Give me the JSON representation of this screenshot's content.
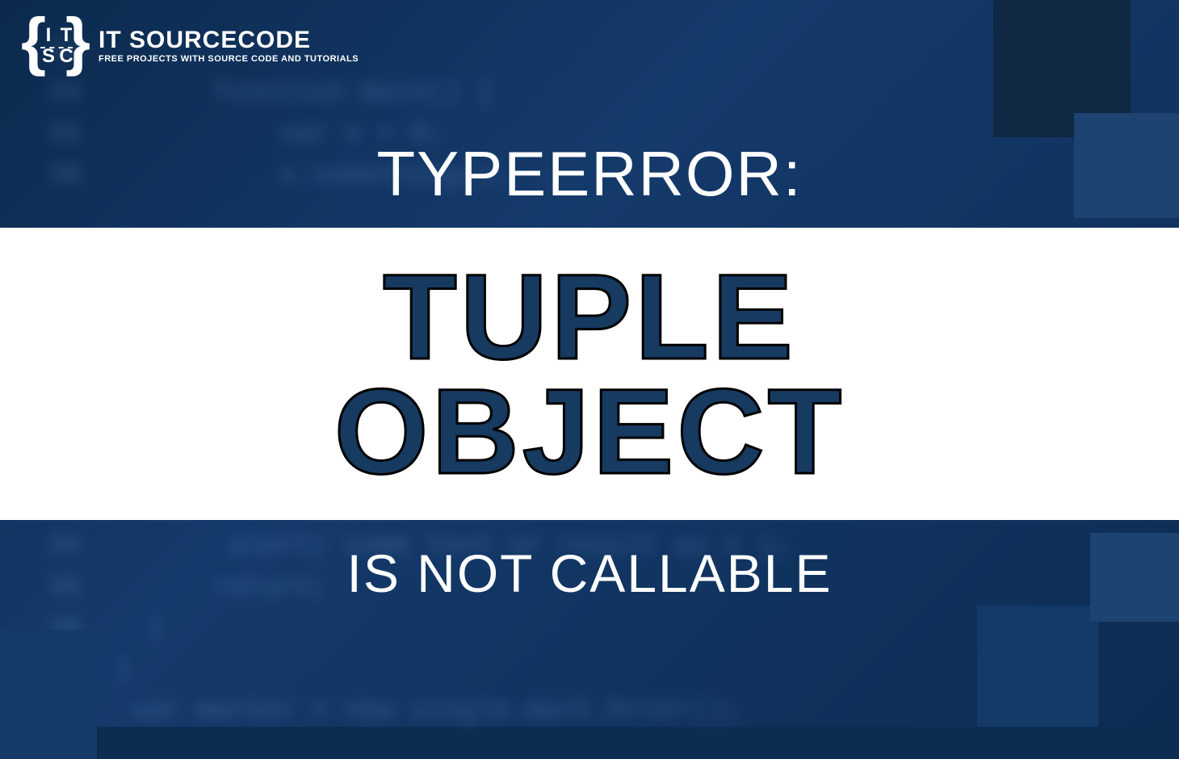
{
  "brand": {
    "mark_letters": [
      "I",
      "T",
      "S",
      "C"
    ],
    "name": "IT SOURCECODE",
    "tagline": "FREE PROJECTS WITH SOURCE CODE AND TUTORIALS"
  },
  "headline": {
    "top": "TYPEERROR:",
    "mid_line1": "TUPLE",
    "mid_line2": "OBJECT",
    "bottom": "IS NOT CALLABLE"
  },
  "bg_code": "33\n34        function main() {\n35            var x = 0;\n36            x.something();\n\n\n\n\n\n\n\n\n34         alert( some text or result as x );\n35        return;\n36    }\n37  }\n38   var marker = new single.mark.brier();"
}
